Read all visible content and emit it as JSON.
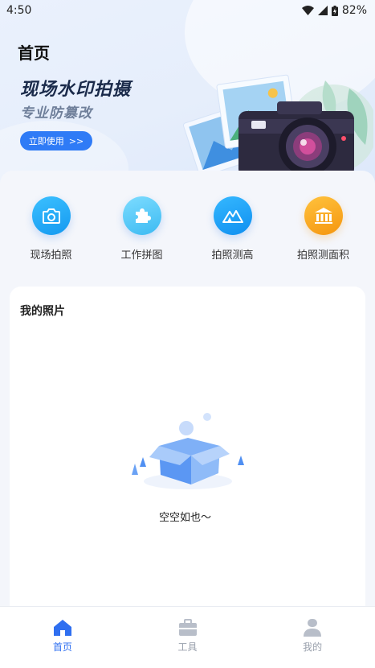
{
  "status_bar": {
    "time": "4:50",
    "battery": "82%"
  },
  "header": {
    "title": "首页"
  },
  "banner": {
    "title": "现场水印拍摄",
    "subtitle": "专业防篡改",
    "button_label": "立即使用",
    "button_arrow": ">>"
  },
  "tools": [
    {
      "label": "现场拍照",
      "icon": "camera-icon",
      "color": "#1fa6f5"
    },
    {
      "label": "工作拼图",
      "icon": "puzzle-icon",
      "color": "#49c6f5"
    },
    {
      "label": "拍照测高",
      "icon": "mountain-icon",
      "color": "#1a9cf5"
    },
    {
      "label": "拍照测面积",
      "icon": "bank-icon",
      "color": "#f9a51b"
    }
  ],
  "photos": {
    "title": "我的照片",
    "empty_text": "空空如也～"
  },
  "bottom_nav": {
    "items": [
      {
        "label": "首页",
        "icon": "home-icon",
        "active": true
      },
      {
        "label": "工具",
        "icon": "toolbox-icon",
        "active": false
      },
      {
        "label": "我的",
        "icon": "user-icon",
        "active": false
      }
    ]
  },
  "colors": {
    "accent": "#2f6ff0",
    "inactive": "#9aa1ad"
  }
}
